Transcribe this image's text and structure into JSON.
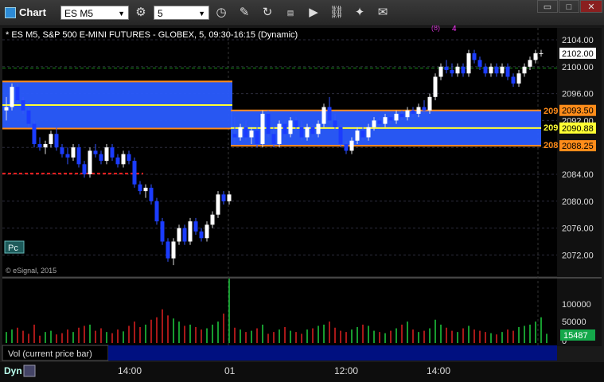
{
  "app": {
    "title": "Chart"
  },
  "toolbar": {
    "symbol": "ES M5",
    "interval": "5",
    "icons": [
      "settings-icon",
      "clock-icon",
      "pencil-icon",
      "redo-icon",
      "data-icon",
      "play-icon",
      "link-icon",
      "chat-icon"
    ]
  },
  "window": {
    "controls": [
      "restore",
      "maximize",
      "close"
    ]
  },
  "chart": {
    "header": "* ES M5, S&P 500 E-MINI FUTURES - GLOBEX, 5, 09:30-16:15 (Dynamic)",
    "copyright": "© eSignal, 2015",
    "pc_button": "Pc",
    "price_axis": [
      "2104.00",
      "2100.00",
      "2096.00",
      "2092.00",
      "2088.00",
      "2084.00",
      "2080.00",
      "2076.00",
      "2072.00"
    ],
    "price_markers": [
      {
        "label": "2102.00",
        "color": "#ffffff",
        "price": 2102.0
      },
      {
        "label": "2093.50",
        "color": "#ff8c1a",
        "price": 2093.5
      },
      {
        "label": "2090.88",
        "color": "#ffff33",
        "price": 2090.88
      },
      {
        "label": "2088.25",
        "color": "#ff8c1a",
        "price": 2088.25
      }
    ],
    "level_labels": [
      "209",
      "209",
      "208"
    ],
    "td_top": "4",
    "td_top_paren": "(8)",
    "vol_axis": [
      "100000",
      "50000",
      "0"
    ],
    "vol_marker": "15487",
    "vol_label": "Vol (current price bar)",
    "time_axis": [
      "14:00",
      "01",
      "12:00",
      "14:00"
    ],
    "dyn_label": "Dyn"
  },
  "chart_data": {
    "type": "candlestick",
    "symbol": "ES M5",
    "ylim": [
      2069,
      2106
    ],
    "vol_ylim": [
      0,
      140000
    ],
    "zones": [
      {
        "start_index": 0,
        "end_index": 40,
        "top": 2097.8,
        "mid": 2094.3,
        "bottom": 2090.8,
        "fill": "#2a5cff"
      },
      {
        "start_index": 41,
        "end_index": 97,
        "top": 2093.5,
        "mid": 2090.88,
        "bottom": 2088.25,
        "fill": "#2a5cff"
      }
    ],
    "candles": [
      {
        "o": 2093.5,
        "h": 2095.5,
        "l": 2092.0,
        "c": 2094.0
      },
      {
        "o": 2094.0,
        "h": 2097.5,
        "l": 2093.5,
        "c": 2097.0
      },
      {
        "o": 2097.0,
        "h": 2097.5,
        "l": 2094.5,
        "c": 2095.0
      },
      {
        "o": 2095.0,
        "h": 2095.5,
        "l": 2093.0,
        "c": 2093.5
      },
      {
        "o": 2093.5,
        "h": 2094.0,
        "l": 2091.0,
        "c": 2091.5
      },
      {
        "o": 2091.5,
        "h": 2092.0,
        "l": 2088.0,
        "c": 2088.5
      },
      {
        "o": 2088.5,
        "h": 2089.5,
        "l": 2087.5,
        "c": 2088.0
      },
      {
        "o": 2088.0,
        "h": 2089.0,
        "l": 2087.0,
        "c": 2088.5
      },
      {
        "o": 2088.5,
        "h": 2090.5,
        "l": 2088.0,
        "c": 2090.0
      },
      {
        "o": 2090.0,
        "h": 2091.0,
        "l": 2087.5,
        "c": 2088.0
      },
      {
        "o": 2088.0,
        "h": 2088.5,
        "l": 2086.5,
        "c": 2087.0
      },
      {
        "o": 2087.0,
        "h": 2088.0,
        "l": 2085.5,
        "c": 2086.5
      },
      {
        "o": 2086.5,
        "h": 2088.5,
        "l": 2086.0,
        "c": 2088.0
      },
      {
        "o": 2088.0,
        "h": 2088.5,
        "l": 2085.0,
        "c": 2085.5
      },
      {
        "o": 2085.5,
        "h": 2086.0,
        "l": 2083.5,
        "c": 2084.0
      },
      {
        "o": 2084.0,
        "h": 2088.0,
        "l": 2083.5,
        "c": 2087.5
      },
      {
        "o": 2087.5,
        "h": 2088.5,
        "l": 2086.5,
        "c": 2087.0
      },
      {
        "o": 2087.0,
        "h": 2087.5,
        "l": 2085.5,
        "c": 2086.0
      },
      {
        "o": 2086.0,
        "h": 2088.5,
        "l": 2085.5,
        "c": 2088.0
      },
      {
        "o": 2088.0,
        "h": 2088.5,
        "l": 2086.0,
        "c": 2086.5
      },
      {
        "o": 2086.5,
        "h": 2087.0,
        "l": 2085.0,
        "c": 2085.5
      },
      {
        "o": 2085.5,
        "h": 2087.5,
        "l": 2085.0,
        "c": 2087.0
      },
      {
        "o": 2087.0,
        "h": 2087.5,
        "l": 2085.5,
        "c": 2086.0
      },
      {
        "o": 2086.0,
        "h": 2086.5,
        "l": 2082.0,
        "c": 2082.5
      },
      {
        "o": 2082.5,
        "h": 2083.0,
        "l": 2081.0,
        "c": 2081.5
      },
      {
        "o": 2081.5,
        "h": 2082.5,
        "l": 2080.5,
        "c": 2082.0
      },
      {
        "o": 2082.0,
        "h": 2082.5,
        "l": 2079.5,
        "c": 2080.0
      },
      {
        "o": 2080.0,
        "h": 2080.5,
        "l": 2076.5,
        "c": 2077.0
      },
      {
        "o": 2077.0,
        "h": 2077.5,
        "l": 2073.5,
        "c": 2074.0
      },
      {
        "o": 2074.0,
        "h": 2074.5,
        "l": 2071.0,
        "c": 2071.5
      },
      {
        "o": 2071.5,
        "h": 2074.5,
        "l": 2070.5,
        "c": 2074.0
      },
      {
        "o": 2074.0,
        "h": 2076.5,
        "l": 2073.5,
        "c": 2076.0
      },
      {
        "o": 2076.0,
        "h": 2076.5,
        "l": 2073.5,
        "c": 2074.0
      },
      {
        "o": 2074.0,
        "h": 2077.5,
        "l": 2073.5,
        "c": 2077.0
      },
      {
        "o": 2077.0,
        "h": 2077.5,
        "l": 2075.0,
        "c": 2075.5
      },
      {
        "o": 2075.5,
        "h": 2076.0,
        "l": 2074.0,
        "c": 2074.5
      },
      {
        "o": 2074.5,
        "h": 2077.0,
        "l": 2074.0,
        "c": 2076.5
      },
      {
        "o": 2076.5,
        "h": 2078.5,
        "l": 2076.0,
        "c": 2078.0
      },
      {
        "o": 2078.0,
        "h": 2081.5,
        "l": 2077.5,
        "c": 2081.0
      },
      {
        "o": 2081.0,
        "h": 2081.5,
        "l": 2079.5,
        "c": 2080.0
      },
      {
        "o": 2080.0,
        "h": 2081.5,
        "l": 2079.5,
        "c": 2081.0
      },
      {
        "o": 2090.0,
        "h": 2092.5,
        "l": 2088.5,
        "c": 2089.5
      },
      {
        "o": 2089.5,
        "h": 2091.5,
        "l": 2089.0,
        "c": 2091.0
      },
      {
        "o": 2091.0,
        "h": 2092.0,
        "l": 2089.0,
        "c": 2089.5
      },
      {
        "o": 2089.5,
        "h": 2091.0,
        "l": 2088.5,
        "c": 2090.5
      },
      {
        "o": 2090.5,
        "h": 2091.5,
        "l": 2088.0,
        "c": 2088.5
      },
      {
        "o": 2088.5,
        "h": 2093.5,
        "l": 2088.0,
        "c": 2093.0
      },
      {
        "o": 2093.0,
        "h": 2093.5,
        "l": 2089.5,
        "c": 2090.0
      },
      {
        "o": 2090.0,
        "h": 2091.0,
        "l": 2088.0,
        "c": 2088.5
      },
      {
        "o": 2088.5,
        "h": 2092.0,
        "l": 2088.0,
        "c": 2091.5
      },
      {
        "o": 2091.5,
        "h": 2092.0,
        "l": 2089.5,
        "c": 2090.0
      },
      {
        "o": 2090.0,
        "h": 2092.5,
        "l": 2089.5,
        "c": 2092.0
      },
      {
        "o": 2092.0,
        "h": 2092.5,
        "l": 2090.5,
        "c": 2091.0
      },
      {
        "o": 2091.0,
        "h": 2092.0,
        "l": 2089.0,
        "c": 2089.5
      },
      {
        "o": 2089.5,
        "h": 2091.5,
        "l": 2089.0,
        "c": 2091.0
      },
      {
        "o": 2091.0,
        "h": 2091.5,
        "l": 2089.5,
        "c": 2090.0
      },
      {
        "o": 2090.0,
        "h": 2092.0,
        "l": 2089.5,
        "c": 2091.5
      },
      {
        "o": 2091.5,
        "h": 2094.5,
        "l": 2091.0,
        "c": 2094.0
      },
      {
        "o": 2094.0,
        "h": 2095.5,
        "l": 2091.5,
        "c": 2092.0
      },
      {
        "o": 2092.0,
        "h": 2093.0,
        "l": 2090.5,
        "c": 2091.0
      },
      {
        "o": 2091.0,
        "h": 2091.5,
        "l": 2088.0,
        "c": 2088.5
      },
      {
        "o": 2088.5,
        "h": 2089.0,
        "l": 2087.0,
        "c": 2087.5
      },
      {
        "o": 2087.5,
        "h": 2089.5,
        "l": 2087.0,
        "c": 2089.0
      },
      {
        "o": 2089.0,
        "h": 2091.0,
        "l": 2088.5,
        "c": 2090.5
      },
      {
        "o": 2090.5,
        "h": 2091.0,
        "l": 2089.0,
        "c": 2089.5
      },
      {
        "o": 2089.5,
        "h": 2091.5,
        "l": 2089.0,
        "c": 2091.0
      },
      {
        "o": 2091.0,
        "h": 2092.5,
        "l": 2090.5,
        "c": 2092.0
      },
      {
        "o": 2092.0,
        "h": 2092.5,
        "l": 2091.0,
        "c": 2091.5
      },
      {
        "o": 2091.5,
        "h": 2093.0,
        "l": 2091.0,
        "c": 2092.5
      },
      {
        "o": 2092.5,
        "h": 2093.0,
        "l": 2091.5,
        "c": 2092.0
      },
      {
        "o": 2092.0,
        "h": 2093.5,
        "l": 2091.5,
        "c": 2093.0
      },
      {
        "o": 2093.0,
        "h": 2093.5,
        "l": 2092.0,
        "c": 2092.5
      },
      {
        "o": 2092.5,
        "h": 2094.0,
        "l": 2092.0,
        "c": 2093.5
      },
      {
        "o": 2093.5,
        "h": 2094.0,
        "l": 2092.5,
        "c": 2093.0
      },
      {
        "o": 2093.0,
        "h": 2094.5,
        "l": 2092.5,
        "c": 2094.0
      },
      {
        "o": 2094.0,
        "h": 2095.0,
        "l": 2093.0,
        "c": 2093.5
      },
      {
        "o": 2093.5,
        "h": 2096.0,
        "l": 2093.0,
        "c": 2095.5
      },
      {
        "o": 2095.5,
        "h": 2099.0,
        "l": 2095.0,
        "c": 2098.5
      },
      {
        "o": 2098.5,
        "h": 2100.5,
        "l": 2098.0,
        "c": 2100.0
      },
      {
        "o": 2100.0,
        "h": 2101.0,
        "l": 2099.0,
        "c": 2099.5
      },
      {
        "o": 2099.5,
        "h": 2100.5,
        "l": 2098.5,
        "c": 2099.0
      },
      {
        "o": 2099.0,
        "h": 2100.5,
        "l": 2098.5,
        "c": 2100.0
      },
      {
        "o": 2100.0,
        "h": 2100.5,
        "l": 2098.5,
        "c": 2099.0
      },
      {
        "o": 2099.0,
        "h": 2102.5,
        "l": 2098.5,
        "c": 2102.0
      },
      {
        "o": 2102.0,
        "h": 2102.5,
        "l": 2100.5,
        "c": 2101.0
      },
      {
        "o": 2101.0,
        "h": 2101.5,
        "l": 2099.5,
        "c": 2100.0
      },
      {
        "o": 2100.0,
        "h": 2100.5,
        "l": 2098.5,
        "c": 2099.0
      },
      {
        "o": 2099.0,
        "h": 2100.5,
        "l": 2098.5,
        "c": 2100.0
      },
      {
        "o": 2100.0,
        "h": 2100.5,
        "l": 2098.5,
        "c": 2099.0
      },
      {
        "o": 2099.0,
        "h": 2100.5,
        "l": 2098.5,
        "c": 2100.0
      },
      {
        "o": 2100.0,
        "h": 2100.5,
        "l": 2098.0,
        "c": 2098.5
      },
      {
        "o": 2098.5,
        "h": 2099.0,
        "l": 2097.0,
        "c": 2097.5
      },
      {
        "o": 2097.5,
        "h": 2099.5,
        "l": 2097.0,
        "c": 2099.0
      },
      {
        "o": 2099.0,
        "h": 2100.5,
        "l": 2098.5,
        "c": 2100.0
      },
      {
        "o": 2100.0,
        "h": 2101.5,
        "l": 2099.5,
        "c": 2101.0
      },
      {
        "o": 2101.0,
        "h": 2102.5,
        "l": 2100.5,
        "c": 2102.0
      },
      {
        "o": 2102.0,
        "h": 2102.5,
        "l": 2101.5,
        "c": 2102.0
      }
    ],
    "volume": [
      18,
      22,
      25,
      20,
      15,
      30,
      12,
      18,
      20,
      14,
      16,
      22,
      18,
      25,
      28,
      30,
      20,
      24,
      18,
      16,
      22,
      19,
      28,
      35,
      26,
      30,
      38,
      42,
      55,
      45,
      40,
      35,
      28,
      30,
      26,
      22,
      24,
      30,
      35,
      48,
      105,
      25,
      22,
      18,
      20,
      24,
      30,
      15,
      18,
      22,
      26,
      20,
      18,
      15,
      22,
      24,
      28,
      30,
      35,
      25,
      20,
      18,
      22,
      26,
      30,
      28,
      20,
      18,
      16,
      20,
      24,
      30,
      35,
      22,
      18,
      20,
      24,
      38,
      30,
      25,
      20,
      18,
      24,
      28,
      22,
      20,
      18,
      16,
      14,
      18,
      22,
      20,
      26,
      28,
      30,
      35,
      42,
      15
    ]
  }
}
